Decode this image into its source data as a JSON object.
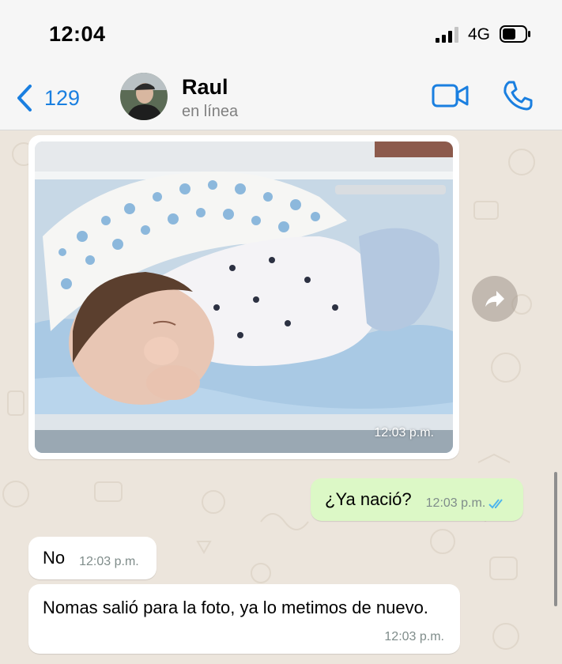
{
  "status_bar": {
    "time": "12:04",
    "network": "4G",
    "signal_icon": "signal-bars-icon",
    "battery_icon": "battery-icon"
  },
  "header": {
    "back_count": "129",
    "back_icon": "chevron-left-icon",
    "contact_name": "Raul",
    "contact_status": "en línea",
    "video_icon": "video-camera-icon",
    "call_icon": "phone-icon"
  },
  "colors": {
    "accent": "#1a7fe0",
    "outgoing_bubble": "#dcf8c6",
    "incoming_bubble": "#ffffff",
    "chat_background": "#ece5dc",
    "read_ticks": "#4fb6ec"
  },
  "messages": [
    {
      "type": "image",
      "direction": "incoming",
      "time": "12:03 p.m.",
      "forward_icon": "forward-arrow-icon"
    },
    {
      "type": "text",
      "direction": "outgoing",
      "text": "¿Ya nació?",
      "time": "12:03 p.m.",
      "status_icon": "double-check-icon"
    },
    {
      "type": "text",
      "direction": "incoming",
      "text": "No",
      "time": "12:03 p.m."
    },
    {
      "type": "text",
      "direction": "incoming",
      "text": "Nomas salió para la foto, ya lo metimos de nuevo.",
      "time": "12:03 p.m."
    }
  ]
}
